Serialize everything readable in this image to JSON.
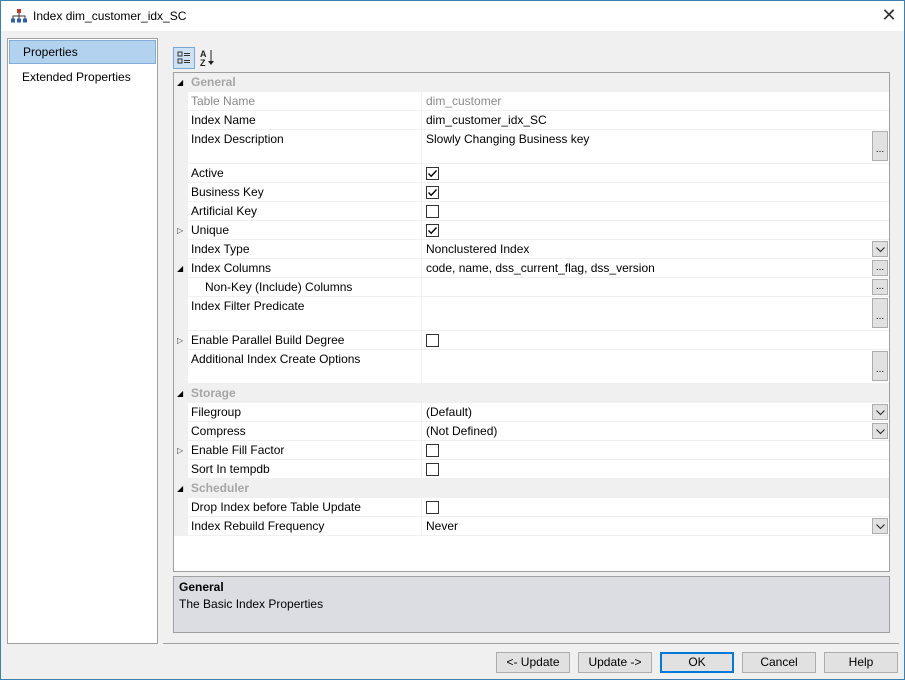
{
  "window": {
    "title": "Index dim_customer_idx_SC",
    "close_glyph": "✕"
  },
  "nav": {
    "items": [
      {
        "label": "Properties",
        "selected": true
      },
      {
        "label": "Extended Properties",
        "selected": false
      }
    ]
  },
  "toolbar": {
    "categorized_icon": "categorized-view-icon",
    "alphabetical_icon": "alphabetical-sort-icon"
  },
  "grid": {
    "general": {
      "label": "General",
      "table_name": {
        "label": "Table Name",
        "value": "dim_customer"
      },
      "index_name": {
        "label": "Index Name",
        "value": "dim_customer_idx_SC"
      },
      "index_description": {
        "label": "Index Description",
        "value": "Slowly Changing Business key"
      },
      "active": {
        "label": "Active",
        "checked": true
      },
      "business_key": {
        "label": "Business Key",
        "checked": true
      },
      "artificial_key": {
        "label": "Artificial Key",
        "checked": false
      },
      "unique": {
        "label": "Unique",
        "checked": true
      },
      "index_type": {
        "label": "Index Type",
        "value": "Nonclustered Index"
      },
      "index_columns": {
        "label": "Index Columns",
        "value": "code, name, dss_current_flag, dss_version"
      },
      "nonkey_columns": {
        "label": "Non-Key (Include) Columns",
        "value": ""
      },
      "filter_predicate": {
        "label": "Index Filter Predicate",
        "value": ""
      },
      "parallel_build": {
        "label": "Enable Parallel Build Degree",
        "checked": false
      },
      "additional_options": {
        "label": "Additional Index Create Options",
        "value": ""
      }
    },
    "storage": {
      "label": "Storage",
      "filegroup": {
        "label": "Filegroup",
        "value": "(Default)"
      },
      "compress": {
        "label": "Compress",
        "value": "(Not Defined)"
      },
      "fill_factor": {
        "label": "Enable Fill Factor",
        "checked": false
      },
      "sort_tempdb": {
        "label": "Sort In tempdb",
        "checked": false
      }
    },
    "scheduler": {
      "label": "Scheduler",
      "drop_index": {
        "label": "Drop Index before Table Update",
        "checked": false
      },
      "rebuild_frequency": {
        "label": "Index Rebuild Frequency",
        "value": "Never"
      }
    },
    "ellipsis": "..."
  },
  "help": {
    "title": "General",
    "description": "The Basic Index Properties"
  },
  "buttons": {
    "update_prev": "<- Update",
    "update_next": "Update ->",
    "ok": "OK",
    "cancel": "Cancel",
    "help": "Help"
  }
}
